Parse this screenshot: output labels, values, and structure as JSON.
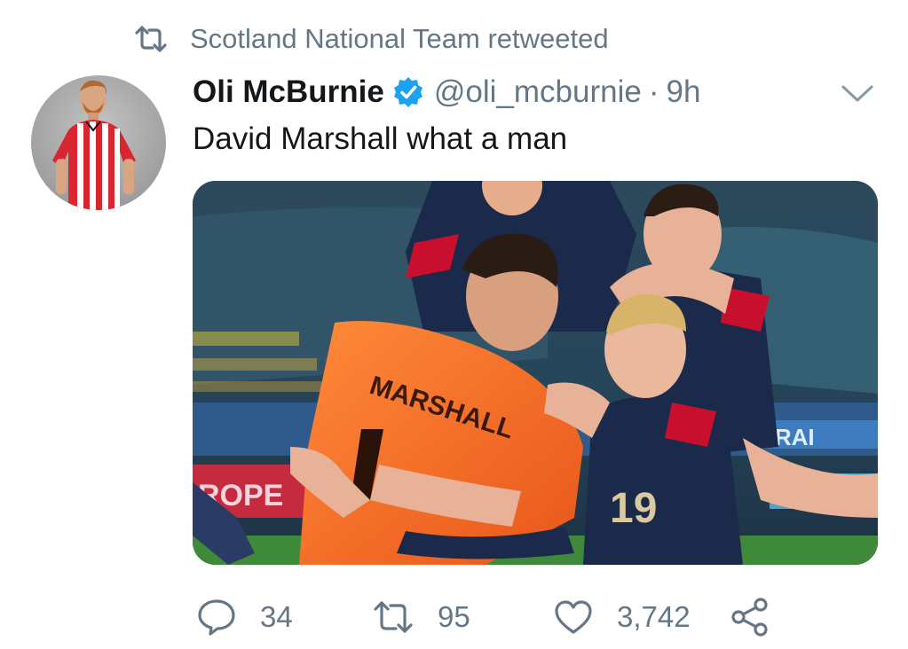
{
  "retweet_header": {
    "icon": "retweet-icon",
    "text": "Scotland National Team retweeted"
  },
  "author": {
    "display_name": "Oli McBurnie",
    "verified": true,
    "handle": "@oli_mcburnie",
    "separator": "·",
    "time": "9h"
  },
  "tweet": {
    "text": "David Marshall what a man",
    "media_image_text": "MARSHALL"
  },
  "actions": {
    "reply": {
      "icon": "reply-icon",
      "count": "34"
    },
    "retweet": {
      "icon": "retweet-icon",
      "count": "95"
    },
    "like": {
      "icon": "heart-icon",
      "count": "3,742"
    },
    "share": {
      "icon": "share-icon"
    }
  },
  "colors": {
    "text_primary": "#14171a",
    "text_secondary": "#657786",
    "verified_blue": "#1da1f2",
    "jersey_orange": "#f26a21",
    "jersey_navy": "#1b2a4a"
  }
}
